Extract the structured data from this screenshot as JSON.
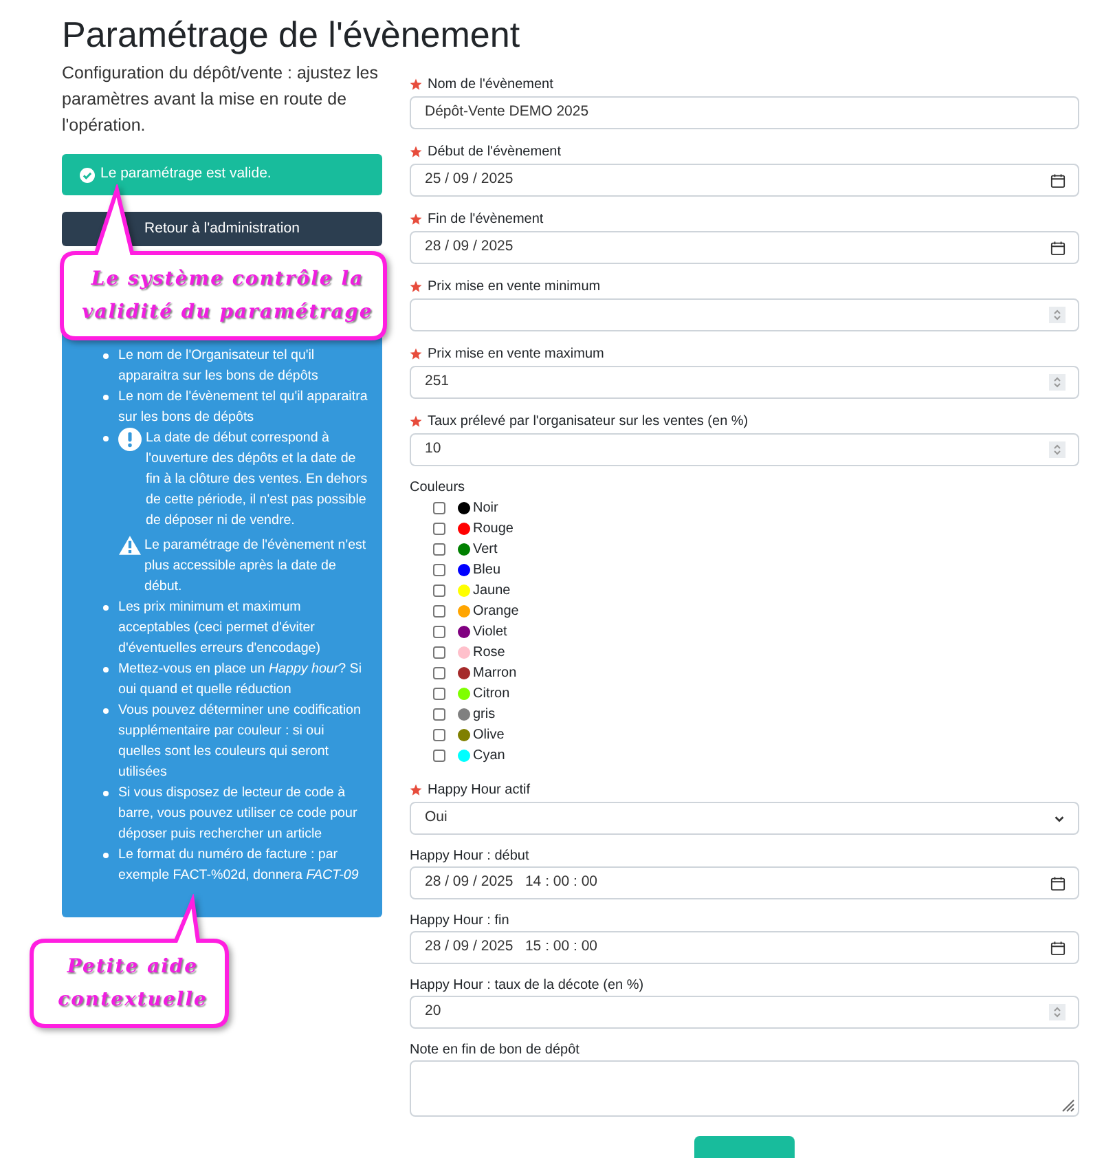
{
  "title": "Paramétrage de l'évènement",
  "intro": "Configuration du dépôt/vente : ajustez les paramètres avant la mise en route de l'opération.",
  "status": {
    "text": "Le paramétrage est valide.",
    "valid": true
  },
  "back_button": "Retour à l'administration",
  "help": [
    {
      "kind": "text",
      "text": "Le nom de l'Organisateur tel qu'il apparaitra sur les bons de dépôts"
    },
    {
      "kind": "text",
      "text": "Le nom de l'évènement tel qu'il apparaitra sur les bons de dépôts"
    },
    {
      "kind": "notice",
      "text": "La date de début correspond à l'ouverture des dépôts et la date de fin à la clôture des ventes. En dehors de cette période, il n'est pas possible de déposer ni de vendre.",
      "warning": "Le paramétrage de l'évènement n'est plus accessible après la date de début."
    },
    {
      "kind": "text",
      "text": "Les prix minimum et maximum acceptables (ceci permet d'éviter d'éventuelles erreurs d'encodage)"
    },
    {
      "kind": "text",
      "text": "Mettez-vous en place un *Happy hour*? Si oui quand et quelle réduction"
    },
    {
      "kind": "text",
      "text": "Vous pouvez déterminer une codification supplémentaire par couleur : si oui quelles sont les couleurs qui seront utilisées"
    },
    {
      "kind": "text",
      "text": "Si vous disposez de lecteur de code à barre, vous pouvez utiliser ce code pour déposer puis rechercher un article"
    },
    {
      "kind": "text",
      "text": "Le format du numéro de facture : par exemple FACT-%02d, donnera *FACT-09*"
    }
  ],
  "fields": [
    {
      "kind": "text",
      "required": true,
      "label": "Nom de l'évènement",
      "value": "Dépôt-Vente DEMO 2025"
    },
    {
      "kind": "date",
      "required": true,
      "label": "Début de l'évènement",
      "value": "25 / 09 / 2025"
    },
    {
      "kind": "date",
      "required": true,
      "label": "Fin de l'évènement",
      "value": "28 / 09 / 2025"
    },
    {
      "kind": "number",
      "required": true,
      "label": "Prix mise en vente minimum"
    },
    {
      "kind": "number",
      "required": true,
      "label": "Prix mise en vente maximum",
      "value": "251"
    },
    {
      "kind": "number",
      "required": true,
      "label": "Taux prélevé par l'organisateur sur les ventes (en %)",
      "value": "10"
    },
    {
      "kind": "colors",
      "required": false,
      "label": "Couleurs",
      "options": [
        {
          "label": "Noir",
          "color": "#000000",
          "checked": false
        },
        {
          "label": "Rouge",
          "color": "#ff0000",
          "checked": false
        },
        {
          "label": "Vert",
          "color": "#008000",
          "checked": false
        },
        {
          "label": "Bleu",
          "color": "#0000ff",
          "checked": false
        },
        {
          "label": "Jaune",
          "color": "#ffff00",
          "checked": false
        },
        {
          "label": "Orange",
          "color": "#ffa500",
          "checked": false
        },
        {
          "label": "Violet",
          "color": "#800080",
          "checked": false
        },
        {
          "label": "Rose",
          "color": "#ffc0cb",
          "checked": false
        },
        {
          "label": "Marron",
          "color": "#a52a2a",
          "checked": false
        },
        {
          "label": "Citron",
          "color": "#7fff00",
          "checked": false
        },
        {
          "label": "gris",
          "color": "#808080",
          "checked": false
        },
        {
          "label": "Olive",
          "color": "#808000",
          "checked": false
        },
        {
          "label": "Cyan",
          "color": "#00ffff",
          "checked": false
        }
      ]
    },
    {
      "kind": "select",
      "required": true,
      "label": "Happy Hour actif",
      "value": "Oui"
    },
    {
      "kind": "date",
      "required": false,
      "label": "Happy Hour : début",
      "value": "28 / 09 / 2025   14 : 00 : 00"
    },
    {
      "kind": "date",
      "required": false,
      "label": "Happy Hour : fin",
      "value": "28 / 09 / 2025   15 : 00 : 00"
    },
    {
      "kind": "number",
      "required": false,
      "label": "Happy Hour : taux de la décote (en %)",
      "value": "20"
    },
    {
      "kind": "textarea",
      "required": false,
      "label": "Note en fin de bon de dépôt"
    }
  ],
  "callouts": [
    {
      "text": "Le système contrôle la validité du paramétrage"
    },
    {
      "text": "Petite aide contextuelle"
    }
  ]
}
